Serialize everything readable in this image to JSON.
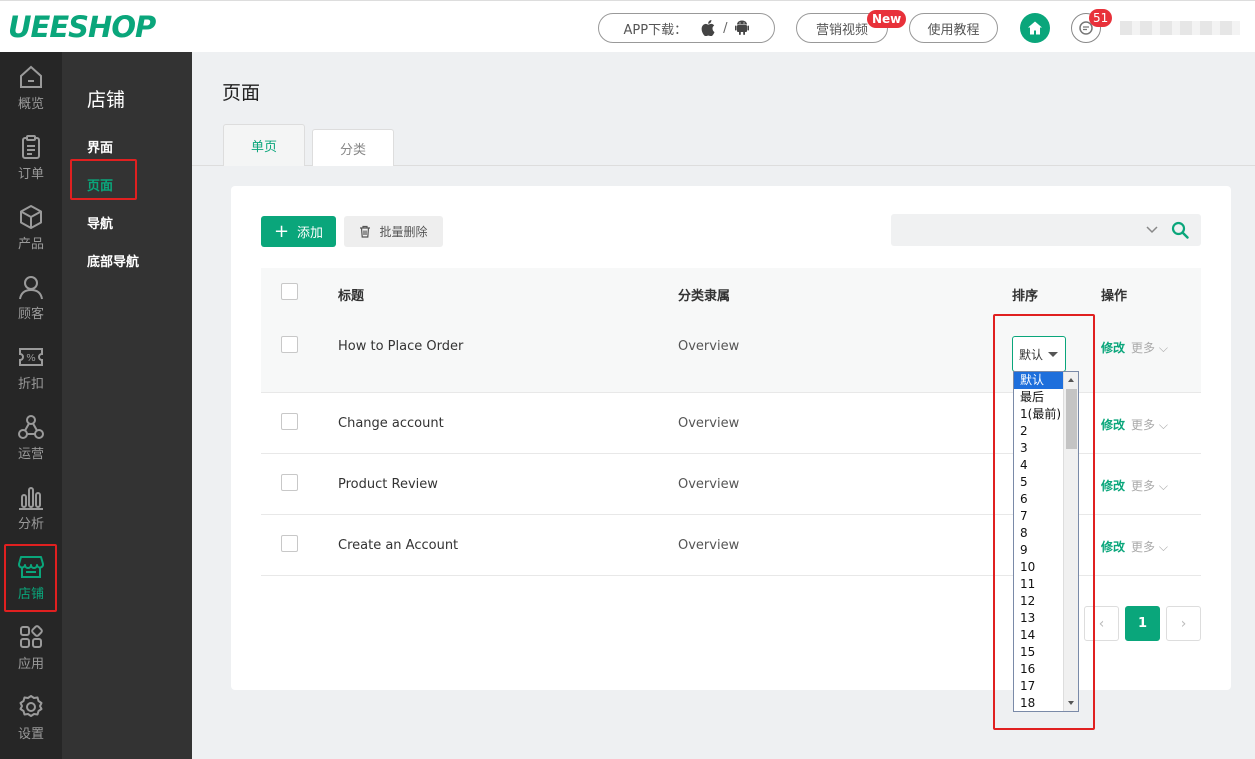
{
  "brand": {
    "logo": "UEESHOP"
  },
  "topbar": {
    "app_download": "APP下载：",
    "slash": "/",
    "marketing_video": "营销视频",
    "new_badge": "New",
    "tutorial": "使用教程",
    "message_count": "51"
  },
  "iconnav": {
    "items": [
      {
        "label": "概览",
        "icon": "home-icon"
      },
      {
        "label": "订单",
        "icon": "clipboard-icon"
      },
      {
        "label": "产品",
        "icon": "box-icon"
      },
      {
        "label": "顾客",
        "icon": "user-icon"
      },
      {
        "label": "折扣",
        "icon": "discount-icon"
      },
      {
        "label": "运营",
        "icon": "network-icon"
      },
      {
        "label": "分析",
        "icon": "bar-chart-icon"
      },
      {
        "label": "店铺",
        "icon": "store-icon",
        "active": true
      },
      {
        "label": "应用",
        "icon": "apps-icon"
      },
      {
        "label": "设置",
        "icon": "gear-icon"
      }
    ]
  },
  "subnav": {
    "title": "店铺",
    "items": [
      {
        "label": "界面"
      },
      {
        "label": "页面",
        "active": true
      },
      {
        "label": "导航"
      },
      {
        "label": "底部导航"
      }
    ]
  },
  "main": {
    "title": "页面",
    "tabs": [
      {
        "label": "单页",
        "active": true
      },
      {
        "label": "分类"
      }
    ],
    "toolbar": {
      "add_label": "添加",
      "add_symbol": "+",
      "batch_delete_label": "批量删除"
    },
    "search": {
      "placeholder": ""
    },
    "table": {
      "headers": {
        "title": "标题",
        "category": "分类隶属",
        "sort": "排序",
        "actions": "操作"
      },
      "rows": [
        {
          "title": "How to Place Order",
          "category": "Overview",
          "edit": "修改",
          "more": "更多"
        },
        {
          "title": "Change account",
          "category": "Overview",
          "edit": "修改",
          "more": "更多"
        },
        {
          "title": "Product Review",
          "category": "Overview",
          "edit": "修改",
          "more": "更多"
        },
        {
          "title": "Create an Account",
          "category": "Overview",
          "edit": "修改",
          "more": "更多"
        }
      ]
    },
    "sort_select": {
      "value": "默认",
      "options": [
        "默认",
        "最后",
        "1(最前)",
        "2",
        "3",
        "4",
        "5",
        "6",
        "7",
        "8",
        "9",
        "10",
        "11",
        "12",
        "13",
        "14",
        "15",
        "16",
        "17",
        "18"
      ]
    },
    "pagination": {
      "prev": "‹",
      "current": "1",
      "next": "›"
    }
  },
  "colors": {
    "accent": "#0aa67b",
    "highlight": "#e02020",
    "badge": "#e8313a"
  }
}
